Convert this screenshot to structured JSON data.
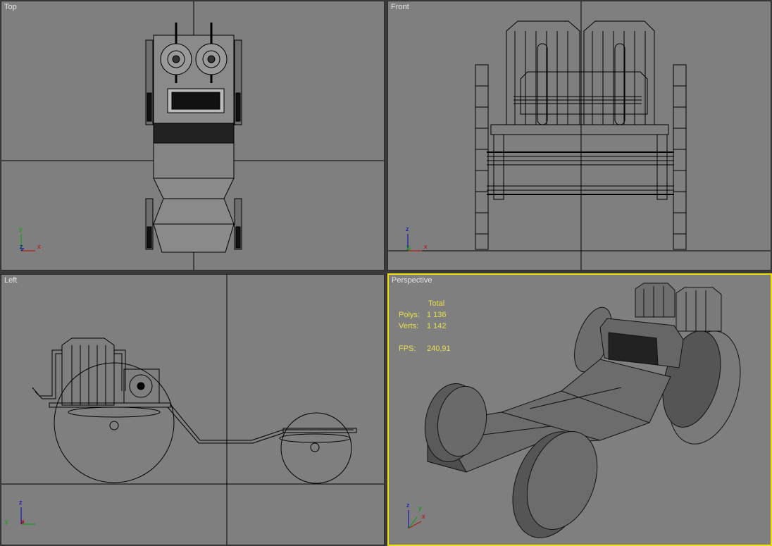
{
  "viewports": {
    "top": {
      "label": "Top"
    },
    "front": {
      "label": "Front"
    },
    "left": {
      "label": "Left"
    },
    "perspective": {
      "label": "Perspective"
    }
  },
  "stats": {
    "header": "Total",
    "polys_label": "Polys:",
    "polys_value": "1 136",
    "verts_label": "Verts:",
    "verts_value": "1 142",
    "fps_label": "FPS:",
    "fps_value": "240,91"
  },
  "axes": {
    "top": {
      "a": "x",
      "b": "y",
      "c": "z"
    },
    "front": {
      "a": "x",
      "b": "z",
      "c": "y"
    },
    "left": {
      "a": "y",
      "b": "z",
      "c": "x"
    },
    "perspective": {
      "a": "x",
      "b": "z",
      "c": "y"
    }
  },
  "colors": {
    "viewport_bg": "#7f7f7f",
    "active_border": "#f0e000",
    "wire": "#000000",
    "grid": "#000000",
    "stats_text": "#e8e14a"
  }
}
